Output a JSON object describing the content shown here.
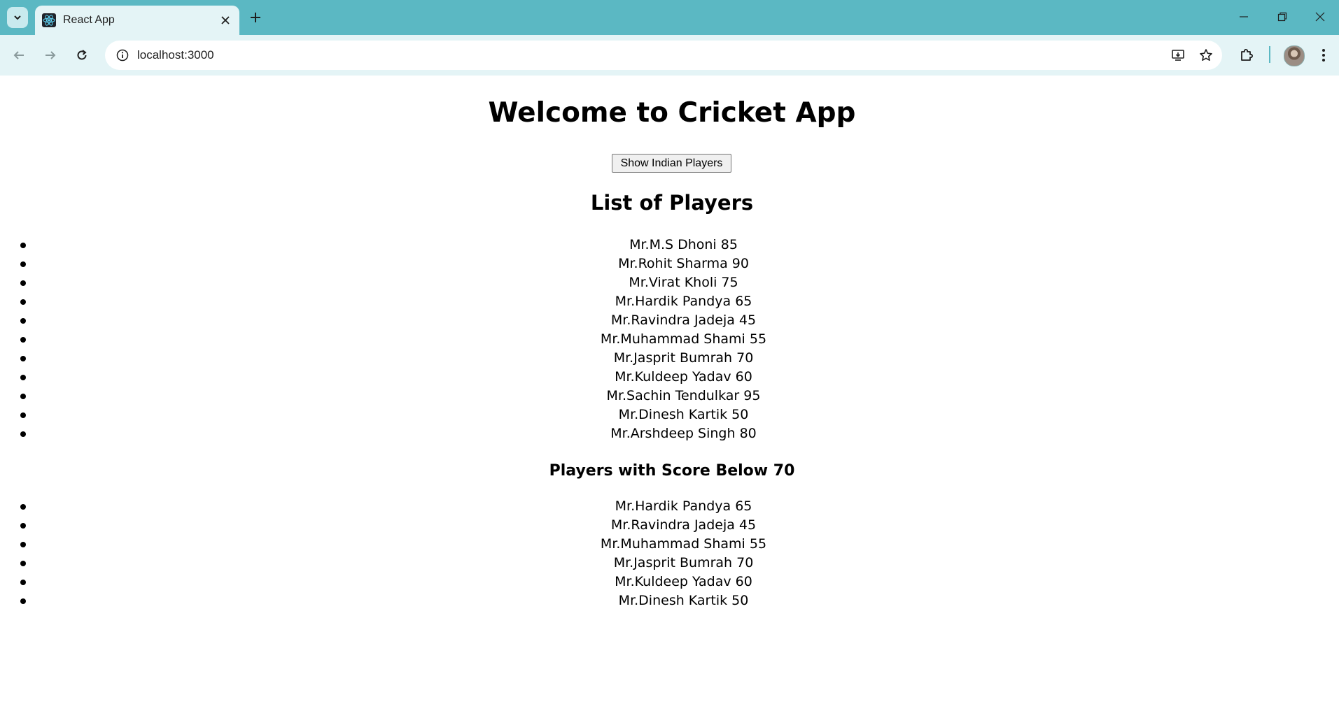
{
  "browser": {
    "tab_title": "React App",
    "url": "localhost:3000",
    "accent": "#5bb8c3"
  },
  "app": {
    "title": "Welcome to Cricket App",
    "show_button_label": "Show Indian Players",
    "list_heading": "List of Players",
    "below_heading": "Players with Score Below 70",
    "players": [
      "Mr.M.S Dhoni 85",
      "Mr.Rohit Sharma 90",
      "Mr.Virat Kholi 75",
      "Mr.Hardik Pandya 65",
      "Mr.Ravindra Jadeja 45",
      "Mr.Muhammad Shami 55",
      "Mr.Jasprit Bumrah 70",
      "Mr.Kuldeep Yadav 60",
      "Mr.Sachin Tendulkar 95",
      "Mr.Dinesh Kartik 50",
      "Mr.Arshdeep Singh 80"
    ],
    "players_below_70": [
      "Mr.Hardik Pandya 65",
      "Mr.Ravindra Jadeja 45",
      "Mr.Muhammad Shami 55",
      "Mr.Jasprit Bumrah 70",
      "Mr.Kuldeep Yadav 60",
      "Mr.Dinesh Kartik 50"
    ]
  }
}
